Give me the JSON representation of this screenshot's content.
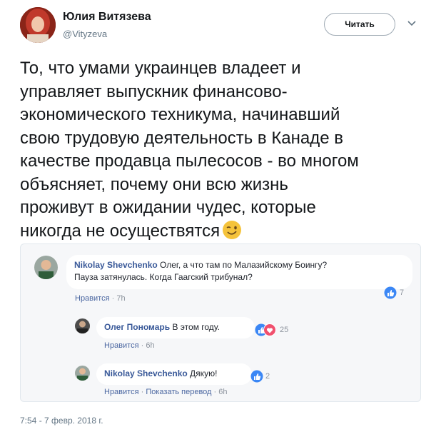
{
  "author": {
    "name": "Юлия Витязева",
    "handle": "@Vityzeva",
    "follow_label": "Читать"
  },
  "tweet": {
    "lines": [
      "То, что умами украинцев владеет и",
      "управляет выпускник финансово-",
      "экономического техникума, начинавший",
      "свою трудовую деятельность в Канаде в",
      "качестве продавца пылесосов - во многом",
      "объясняет, почему они всю жизнь",
      "проживут в ожидании чудес, которые",
      "никогда не осуществятся"
    ],
    "emoji": "wink-emoji",
    "timestamp": "7:54 - 7 февр. 2018 г."
  },
  "embed": {
    "comments": [
      {
        "author": "Nikolay Shevchenko",
        "text_line1": " Олег, а что там по Малазийскому Боингу?",
        "text_line2": "Пауза затянулась. Когда Гаагский трибунал?",
        "like_label": "Нравится",
        "time": "7h",
        "reaction_count": "7"
      },
      {
        "author": "Олег Пономарь",
        "text": " В этом году.",
        "like_label": "Нравится",
        "time": "6h",
        "reaction_count": "25"
      },
      {
        "author": "Nikolay Shevchenko",
        "text": " Дякую!",
        "like_label": "Нравится",
        "translate_label": "Показать перевод",
        "time": "6h",
        "reaction_count": "2"
      }
    ],
    "colors": {
      "like_blue": "#3b87f5",
      "love_red": "#f0506e",
      "name_blue": "#385898"
    }
  }
}
